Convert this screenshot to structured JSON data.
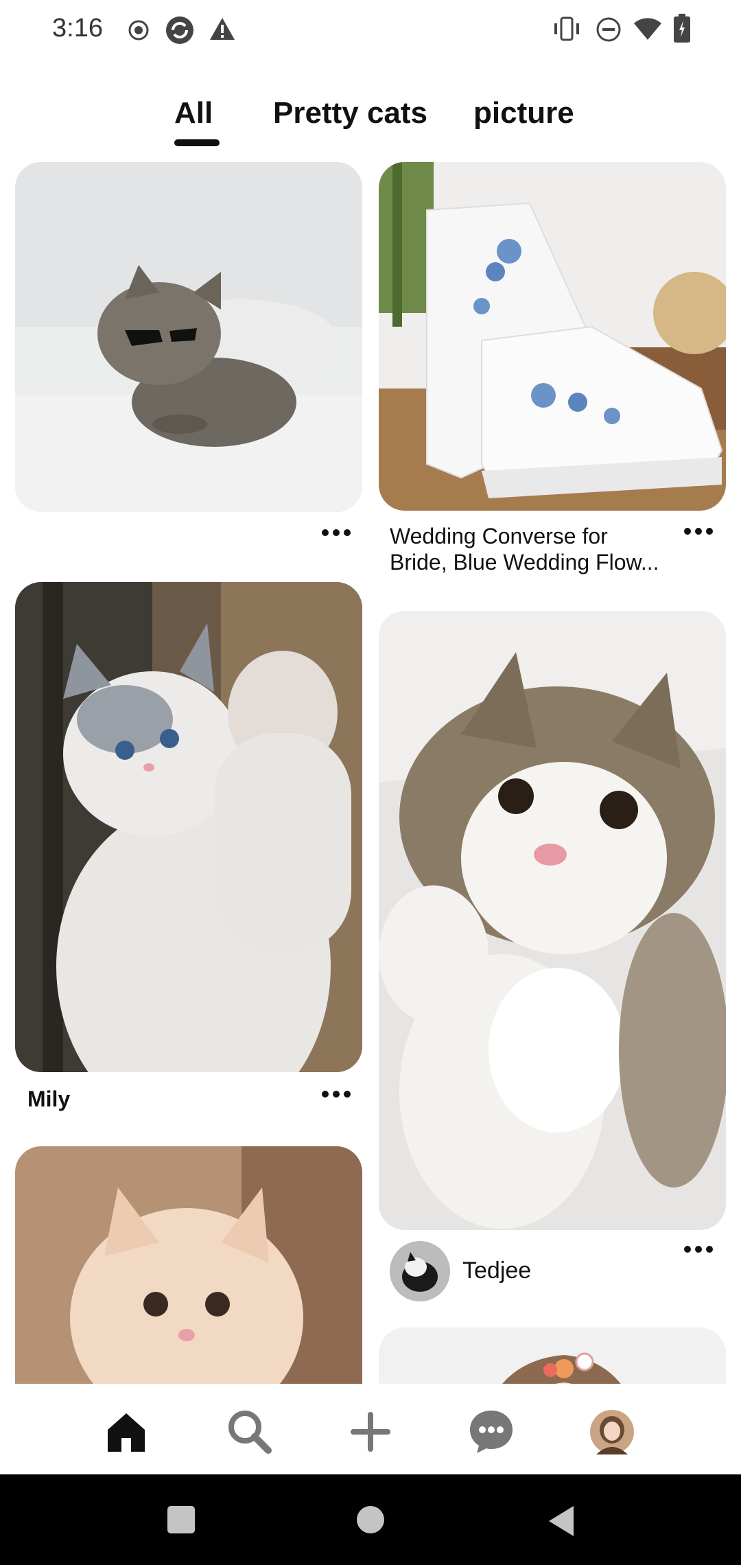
{
  "status": {
    "time": "3:16"
  },
  "tabs": [
    {
      "label": "All"
    },
    {
      "label": "Pretty cats"
    },
    {
      "label": "picture"
    }
  ],
  "pins": {
    "shoes": {
      "title_line1": "Wedding Converse for",
      "title_line2": "Bride, Blue Wedding Flow..."
    },
    "cat_raising_paw": {
      "title": "Mily"
    },
    "cat_lying": {
      "creator": "Tedjee"
    }
  },
  "nav": {
    "home": "home-icon",
    "search": "search-icon",
    "create": "plus-icon",
    "messages": "chat-icon",
    "profile": "avatar"
  },
  "colors": {
    "text": "#111111",
    "system_bar": "#000000"
  }
}
